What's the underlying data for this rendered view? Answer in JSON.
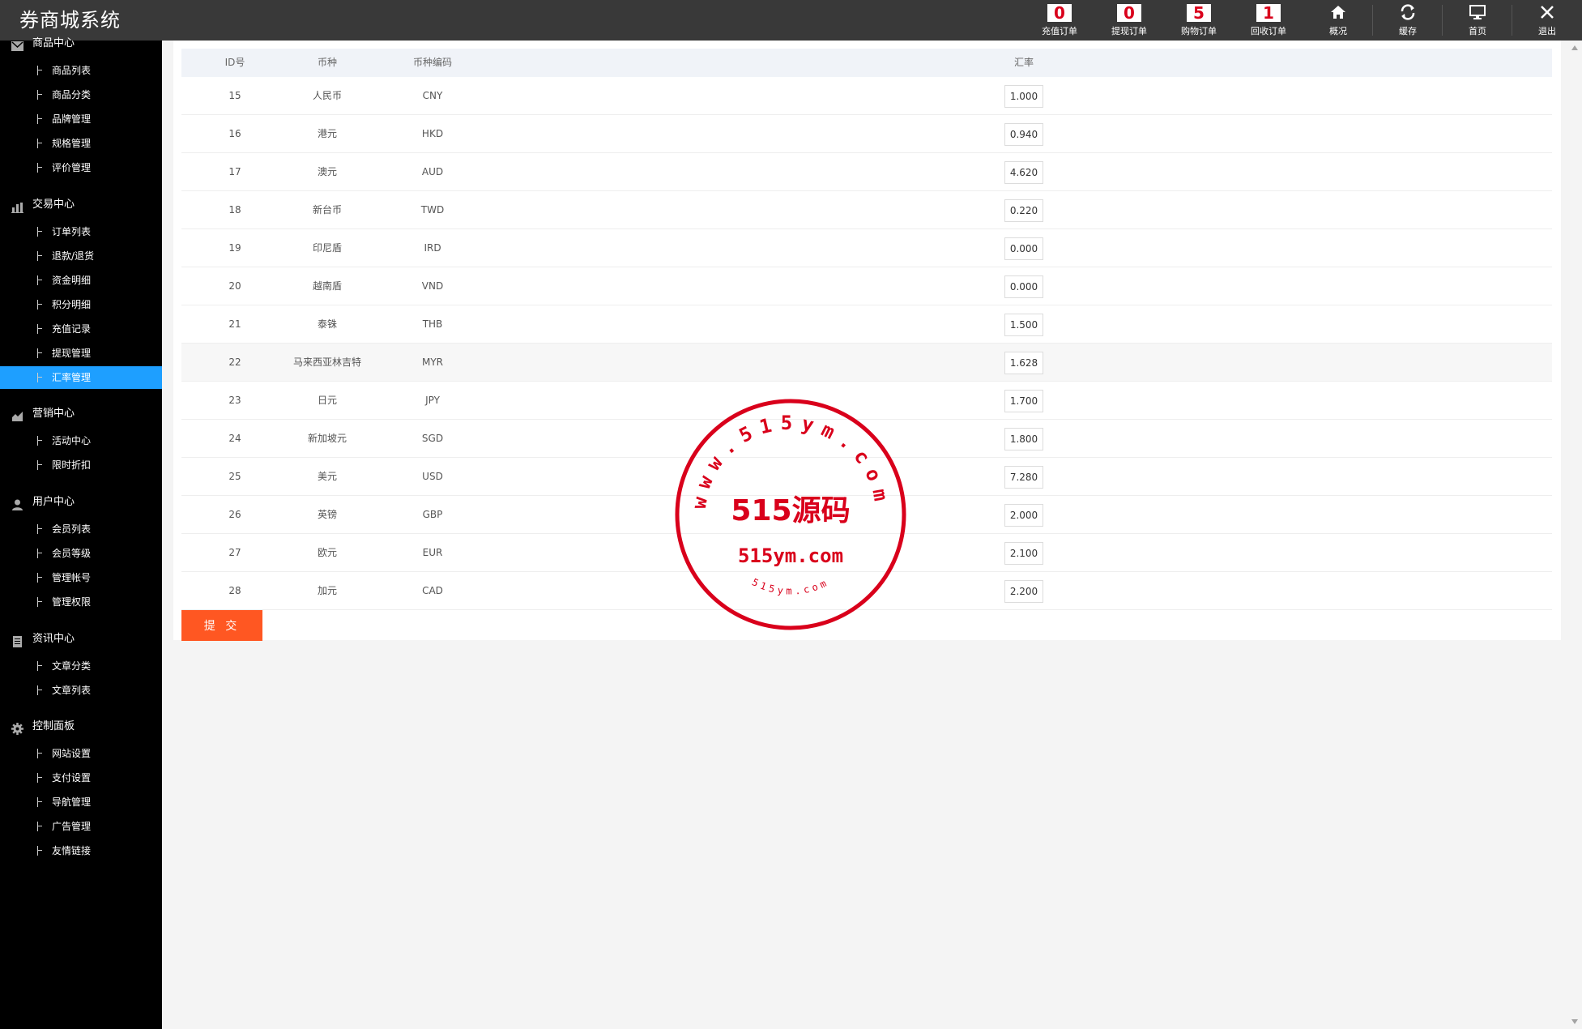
{
  "app": {
    "title": "券商城系统"
  },
  "topnav": [
    {
      "badge": "0",
      "label": "充值订单",
      "icon": ""
    },
    {
      "badge": "0",
      "label": "提现订单",
      "icon": ""
    },
    {
      "badge": "5",
      "label": "购物订单",
      "icon": ""
    },
    {
      "badge": "1",
      "label": "回收订单",
      "icon": ""
    },
    {
      "badge": null,
      "label": "概况",
      "icon": "home-icon"
    },
    {
      "badge": null,
      "label": "缓存",
      "icon": "refresh-icon"
    },
    {
      "badge": null,
      "label": "首页",
      "icon": "monitor-icon"
    },
    {
      "badge": null,
      "label": "退出",
      "icon": "close-icon"
    }
  ],
  "sidebar": {
    "groups": [
      {
        "title": "商品中心",
        "icon": "mail-icon",
        "items": [
          "商品列表",
          "商品分类",
          "品牌管理",
          "规格管理",
          "评价管理"
        ]
      },
      {
        "title": "交易中心",
        "icon": "bar-chart-icon",
        "items": [
          "订单列表",
          "退款/退货",
          "资金明细",
          "积分明细",
          "充值记录",
          "提现管理",
          "汇率管理"
        ]
      },
      {
        "title": "营销中心",
        "icon": "area-chart-icon",
        "items": [
          "活动中心",
          "限时折扣"
        ]
      },
      {
        "title": "用户中心",
        "icon": "user-icon",
        "items": [
          "会员列表",
          "会员等级",
          "管理帐号",
          "管理权限"
        ]
      },
      {
        "title": "资讯中心",
        "icon": "document-icon",
        "items": [
          "文章分类",
          "文章列表"
        ]
      },
      {
        "title": "控制面板",
        "icon": "gear-icon",
        "items": [
          "网站设置",
          "支付设置",
          "导航管理",
          "广告管理",
          "友情链接"
        ]
      }
    ],
    "active_item": "汇率管理"
  },
  "table": {
    "headers": {
      "id": "ID号",
      "name": "币种",
      "code": "币种编码",
      "rate": "汇率"
    },
    "rows": [
      {
        "id": "15",
        "name": "人民币",
        "code": "CNY",
        "rate": "1.000"
      },
      {
        "id": "16",
        "name": "港元",
        "code": "HKD",
        "rate": "0.940"
      },
      {
        "id": "17",
        "name": "澳元",
        "code": "AUD",
        "rate": "4.620"
      },
      {
        "id": "18",
        "name": "新台币",
        "code": "TWD",
        "rate": "0.220"
      },
      {
        "id": "19",
        "name": "印尼盾",
        "code": "IRD",
        "rate": "0.000"
      },
      {
        "id": "20",
        "name": "越南盾",
        "code": "VND",
        "rate": "0.000"
      },
      {
        "id": "21",
        "name": "泰铢",
        "code": "THB",
        "rate": "1.500"
      },
      {
        "id": "22",
        "name": "马来西亚林吉特",
        "code": "MYR",
        "rate": "1.628"
      },
      {
        "id": "23",
        "name": "日元",
        "code": "JPY",
        "rate": "1.700"
      },
      {
        "id": "24",
        "name": "新加坡元",
        "code": "SGD",
        "rate": "1.800"
      },
      {
        "id": "25",
        "name": "美元",
        "code": "USD",
        "rate": "7.280"
      },
      {
        "id": "26",
        "name": "英镑",
        "code": "GBP",
        "rate": "2.000"
      },
      {
        "id": "27",
        "name": "欧元",
        "code": "EUR",
        "rate": "2.100"
      },
      {
        "id": "28",
        "name": "加元",
        "code": "CAD",
        "rate": "2.200"
      }
    ],
    "highlight_row": "22"
  },
  "submit_label": "提 交",
  "watermark": {
    "top_text": "www.515ym.com",
    "center_text": "515源码",
    "sub_text": "515ym.com",
    "bottom_text": "515ym.com"
  },
  "colors": {
    "topbar": "#393939",
    "sidebar": "#000000",
    "active": "#1e9fff",
    "submit": "#ff5722",
    "badge_text": "#d9001b",
    "stamp": "#d9001b"
  }
}
